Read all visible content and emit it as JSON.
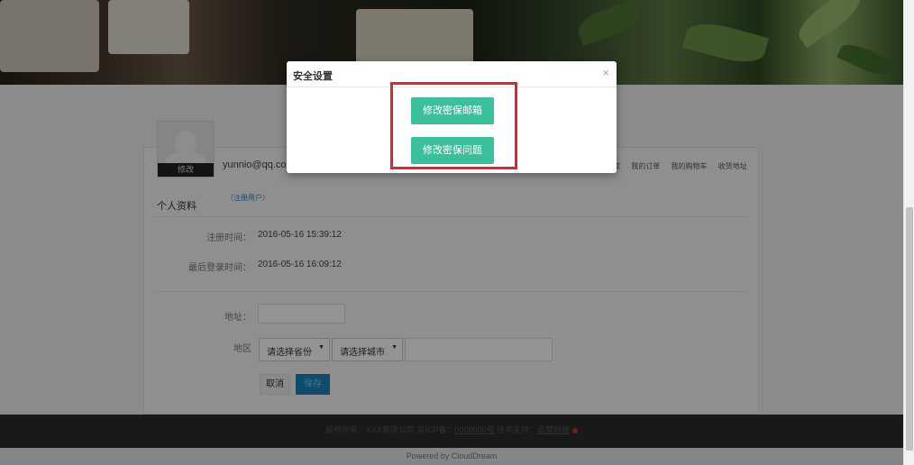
{
  "modal": {
    "title": "安全设置",
    "close_glyph": "×",
    "buttons": [
      "修改密保邮箱",
      "修改密保问题"
    ]
  },
  "profile": {
    "avatar_label": "修改",
    "email": "yunnio@qq.com",
    "links": [
      "我的订单",
      "我的购物车",
      "收货地址"
    ],
    "links_prefix": "库",
    "section_title": "个人资料",
    "user_tag": "（注册用户）",
    "register_time_label": "注册时间：",
    "register_time": "2016-05-16 15:39:12",
    "last_login_label": "最后登录时间：",
    "last_login": "2016-05-16 16:09:12",
    "address_label": "地址：",
    "region_label": "地区",
    "province_select": "请选择省份",
    "city_select": "请选择城市",
    "cancel_label": "取消",
    "save_label": "保存"
  },
  "footer": {
    "text_a": "版权所有：XXX有限公司  京ICP备：",
    "icp": "0000000号",
    "text_b": "  技术支持：",
    "support": "云梦网络",
    "powered": "Powered by CloudDream"
  },
  "colors": {
    "modal_button": "#3cbf9c",
    "highlight": "#e0262c",
    "save_button": "#1a82b8",
    "link": "#2a8bc5"
  }
}
